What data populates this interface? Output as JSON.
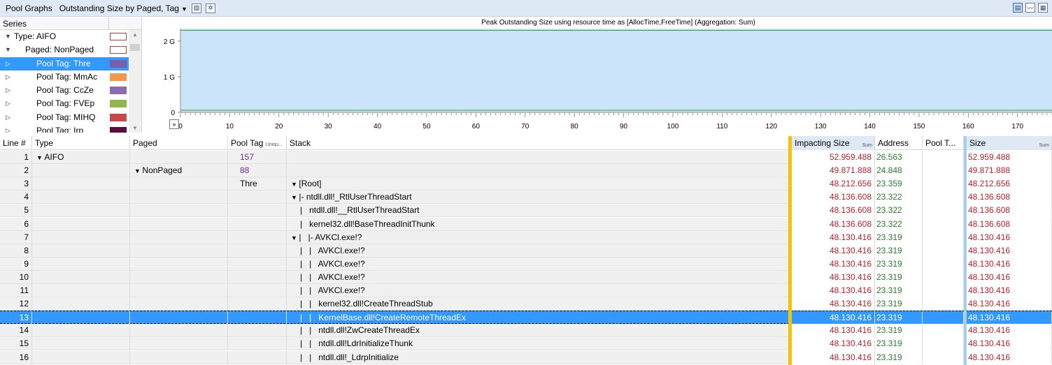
{
  "toolbar": {
    "title": "Pool Graphs",
    "view": "Outstanding Size by Paged, Tag",
    "right_icons": [
      "table-graph-icon",
      "graph-icon",
      "table-icon"
    ]
  },
  "series_panel": {
    "header": "Series",
    "items": [
      {
        "label": "Type: AIFO",
        "indent": 0,
        "expander": "expanded",
        "color": "#ffffff",
        "selected": false
      },
      {
        "label": "Paged: NonPaged",
        "indent": 1,
        "expander": "expanded",
        "color": "#ffffff",
        "selected": false
      },
      {
        "label": "Pool Tag: Thre",
        "indent": 2,
        "expander": "collapsed",
        "color": "#7b5ea7",
        "selected": true
      },
      {
        "label": "Pool Tag: MmAc",
        "indent": 2,
        "expander": "collapsed",
        "color": "#f4994a",
        "selected": false
      },
      {
        "label": "Pool Tag: CcZe",
        "indent": 2,
        "expander": "collapsed",
        "color": "#8b6db5",
        "selected": false
      },
      {
        "label": "Pool Tag: FVEp",
        "indent": 2,
        "expander": "collapsed",
        "color": "#8fb84a",
        "selected": false
      },
      {
        "label": "Pool Tag: MIHQ",
        "indent": 2,
        "expander": "collapsed",
        "color": "#c9484a",
        "selected": false
      },
      {
        "label": "Pool Tag: Irp",
        "indent": 2,
        "expander": "collapsed",
        "color": "#5a0f40",
        "selected": false
      }
    ]
  },
  "chart_data": {
    "type": "area",
    "title": "Peak Outstanding Size using resource time as [AllocTime,FreeTime] (Aggregation: Sum)",
    "yticks": [
      "2 G",
      "1 G",
      "0"
    ],
    "ytick_values": [
      2,
      1,
      0
    ],
    "ylim": [
      0,
      2.35
    ],
    "xticks": [
      0,
      10,
      20,
      30,
      40,
      50,
      60,
      70,
      80,
      90,
      100,
      110,
      120,
      130,
      140,
      150,
      160,
      170
    ],
    "xlim": [
      0,
      177
    ],
    "series": [
      {
        "name": "",
        "color": "#3b9a3b",
        "values": [
          2.3,
          2.3
        ]
      }
    ]
  },
  "table": {
    "columns": {
      "line": "Line #",
      "type": "Type",
      "paged": "Paged",
      "pooltag": "Pool Tag",
      "pooltag_sub": "Uniqu...",
      "stack": "Stack",
      "impacting": "Impacting Size",
      "impacting_sub": "Sum",
      "address": "Address",
      "pooltype": "Pool T...",
      "size": "Size",
      "size_sub": "Sum"
    },
    "rows": [
      {
        "line": "1",
        "type": "AIFO",
        "type_exp": true,
        "paged": "",
        "paged_exp": false,
        "pooltag": "157",
        "stack": "",
        "stack_exp": false,
        "impacting": "52.959.488",
        "address": "26.563",
        "size": "52.959.488",
        "selected": false
      },
      {
        "line": "2",
        "type": "",
        "type_exp": false,
        "paged": "NonPaged",
        "paged_exp": true,
        "pooltag": "88",
        "stack": "",
        "stack_exp": false,
        "impacting": "49.871.888",
        "address": "24.848",
        "size": "49.871.888",
        "selected": false
      },
      {
        "line": "3",
        "type": "",
        "type_exp": false,
        "paged": "",
        "paged_exp": false,
        "pooltag": "Thre",
        "stack": "[Root]",
        "stack_exp": true,
        "stack_indent": 0,
        "impacting": "48.212.656",
        "address": "23.359",
        "size": "48.212.656",
        "selected": false
      },
      {
        "line": "4",
        "type": "",
        "type_exp": false,
        "paged": "",
        "paged_exp": false,
        "pooltag": "",
        "stack": "|- ntdll.dll!_RtlUserThreadStart",
        "stack_exp": true,
        "stack_indent": 0,
        "impacting": "48.136.608",
        "address": "23.322",
        "size": "48.136.608",
        "selected": false
      },
      {
        "line": "5",
        "type": "",
        "type_exp": false,
        "paged": "",
        "paged_exp": false,
        "pooltag": "",
        "stack": "|   ntdll.dll!__RtlUserThreadStart",
        "stack_exp": false,
        "stack_indent": 0,
        "impacting": "48.136.608",
        "address": "23.322",
        "size": "48.136.608",
        "selected": false
      },
      {
        "line": "6",
        "type": "",
        "type_exp": false,
        "paged": "",
        "paged_exp": false,
        "pooltag": "",
        "stack": "|   kernel32.dll!BaseThreadInitThunk",
        "stack_exp": false,
        "stack_indent": 0,
        "impacting": "48.136.608",
        "address": "23.322",
        "size": "48.136.608",
        "selected": false
      },
      {
        "line": "7",
        "type": "",
        "type_exp": false,
        "paged": "",
        "paged_exp": false,
        "pooltag": "",
        "stack": "|   |- AVKCl.exe!?",
        "stack_exp": true,
        "stack_indent": 0,
        "impacting": "48.130.416",
        "address": "23.319",
        "size": "48.130.416",
        "selected": false
      },
      {
        "line": "8",
        "type": "",
        "type_exp": false,
        "paged": "",
        "paged_exp": false,
        "pooltag": "",
        "stack": "|   |   AVKCl.exe!?",
        "stack_exp": false,
        "stack_indent": 0,
        "impacting": "48.130.416",
        "address": "23.319",
        "size": "48.130.416",
        "selected": false
      },
      {
        "line": "9",
        "type": "",
        "type_exp": false,
        "paged": "",
        "paged_exp": false,
        "pooltag": "",
        "stack": "|   |   AVKCl.exe!?",
        "stack_exp": false,
        "stack_indent": 0,
        "impacting": "48.130.416",
        "address": "23.319",
        "size": "48.130.416",
        "selected": false
      },
      {
        "line": "10",
        "type": "",
        "type_exp": false,
        "paged": "",
        "paged_exp": false,
        "pooltag": "",
        "stack": "|   |   AVKCl.exe!?",
        "stack_exp": false,
        "stack_indent": 0,
        "impacting": "48.130.416",
        "address": "23.319",
        "size": "48.130.416",
        "selected": false
      },
      {
        "line": "11",
        "type": "",
        "type_exp": false,
        "paged": "",
        "paged_exp": false,
        "pooltag": "",
        "stack": "|   |   AVKCl.exe!?",
        "stack_exp": false,
        "stack_indent": 0,
        "impacting": "48.130.416",
        "address": "23.319",
        "size": "48.130.416",
        "selected": false
      },
      {
        "line": "12",
        "type": "",
        "type_exp": false,
        "paged": "",
        "paged_exp": false,
        "pooltag": "",
        "stack": "|   |   kernel32.dll!CreateThreadStub",
        "stack_exp": false,
        "stack_indent": 0,
        "impacting": "48.130.416",
        "address": "23.319",
        "size": "48.130.416",
        "selected": false
      },
      {
        "line": "13",
        "type": "",
        "type_exp": false,
        "paged": "",
        "paged_exp": false,
        "pooltag": "",
        "stack": "|   |   KernelBase.dll!CreateRemoteThreadEx",
        "stack_exp": false,
        "stack_indent": 0,
        "impacting": "48.130.416",
        "address": "23.319",
        "size": "48.130.416",
        "selected": true
      },
      {
        "line": "14",
        "type": "",
        "type_exp": false,
        "paged": "",
        "paged_exp": false,
        "pooltag": "",
        "stack": "|   |   ntdll.dll!ZwCreateThreadEx",
        "stack_exp": false,
        "stack_indent": 0,
        "impacting": "48.130.416",
        "address": "23.319",
        "size": "48.130.416",
        "selected": false
      },
      {
        "line": "15",
        "type": "",
        "type_exp": false,
        "paged": "",
        "paged_exp": false,
        "pooltag": "",
        "stack": "|   |   ntdll.dll!LdrInitializeThunk",
        "stack_exp": false,
        "stack_indent": 0,
        "impacting": "48.130.416",
        "address": "23.319",
        "size": "48.130.416",
        "selected": false
      },
      {
        "line": "16",
        "type": "",
        "type_exp": false,
        "paged": "",
        "paged_exp": false,
        "pooltag": "",
        "stack": "|   |   ntdll.dll!_LdrpInitialize",
        "stack_exp": false,
        "stack_indent": 0,
        "impacting": "48.130.416",
        "address": "23.319",
        "size": "48.130.416",
        "selected": false
      }
    ]
  }
}
